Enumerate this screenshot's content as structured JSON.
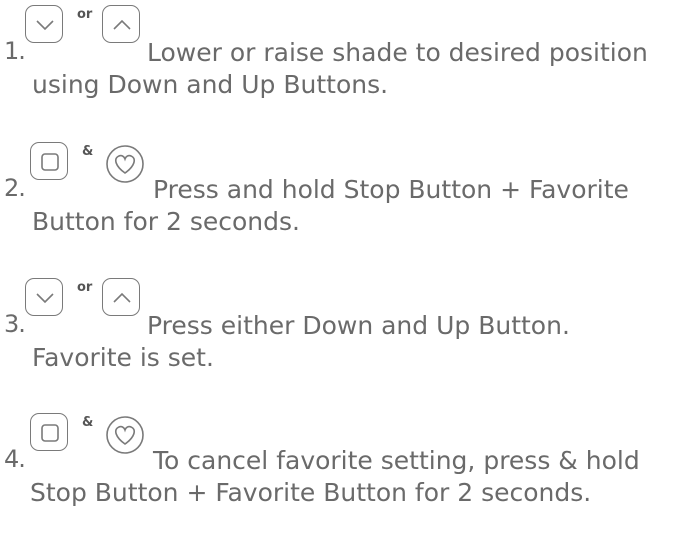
{
  "steps": [
    {
      "number": "1.",
      "buttons": [
        "chevron-down",
        "chevron-up"
      ],
      "connector": "or",
      "line1": "Lower or raise shade to desired position",
      "line2": "using Down and Up Buttons."
    },
    {
      "number": "2.",
      "buttons": [
        "stop",
        "favorite-heart"
      ],
      "connector": "&",
      "line1": "Press and hold Stop Button + Favorite",
      "line2": "Button for 2 seconds."
    },
    {
      "number": "3.",
      "buttons": [
        "chevron-down",
        "chevron-up"
      ],
      "connector": "or",
      "line1": "Press either Down and Up Button.",
      "line2": "Favorite is set."
    },
    {
      "number": "4.",
      "buttons": [
        "stop",
        "favorite-heart"
      ],
      "connector": "&",
      "line1": "To cancel favorite setting, press & hold",
      "line2": "Stop Button + Favorite Button for  2 seconds."
    }
  ]
}
